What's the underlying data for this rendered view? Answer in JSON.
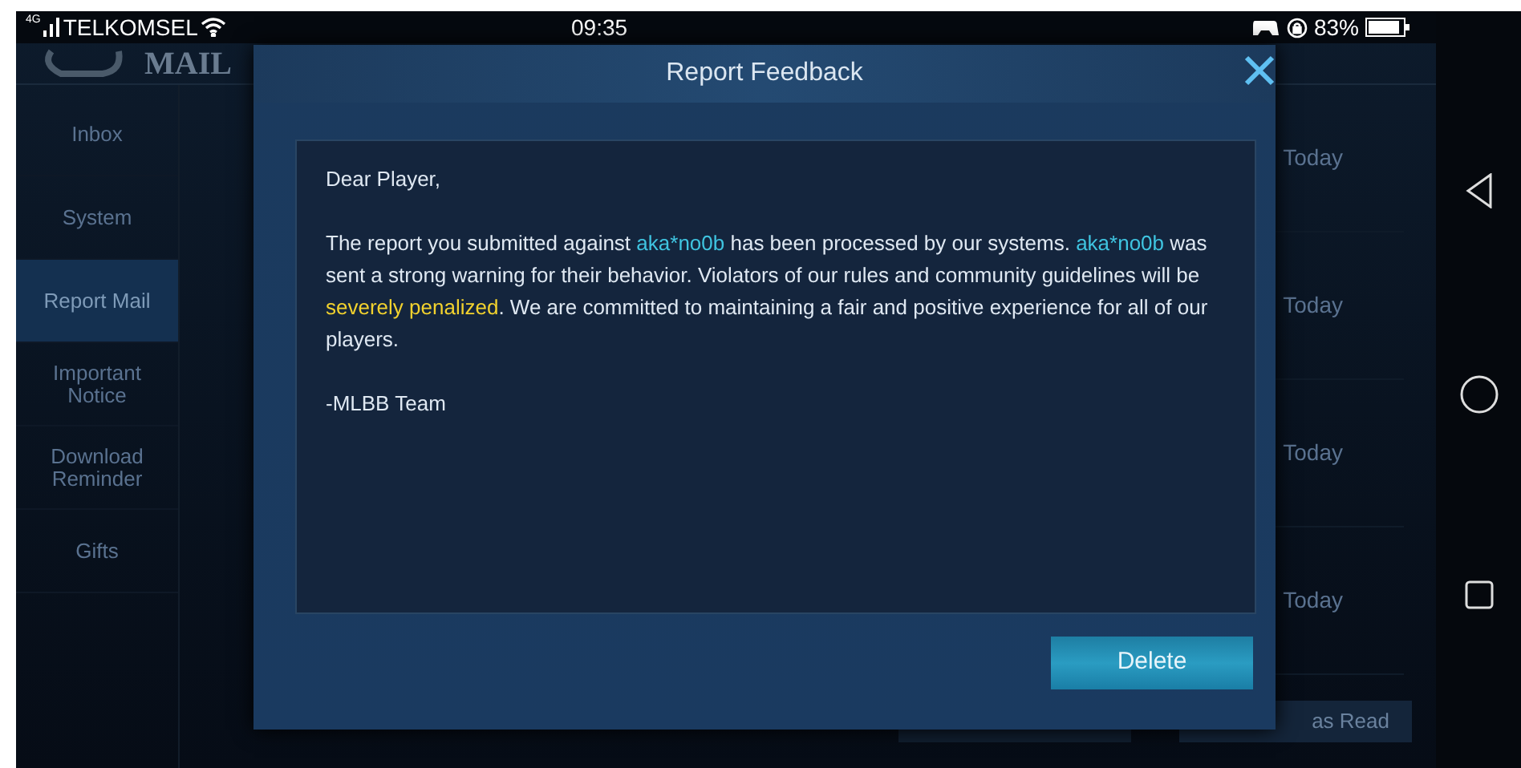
{
  "status_bar": {
    "network": "4G",
    "carrier": "TELKOMSEL",
    "time": "09:35",
    "battery": "83%"
  },
  "header": {
    "title": "MAIL"
  },
  "sidebar": {
    "items": [
      {
        "label": "Inbox",
        "selected": false
      },
      {
        "label": "System",
        "selected": false
      },
      {
        "label": "Report Mail",
        "selected": true
      },
      {
        "label": "Important Notice",
        "selected": false
      },
      {
        "label": "Download Reminder",
        "selected": false
      },
      {
        "label": "Gifts",
        "selected": false
      }
    ]
  },
  "mail_list": {
    "rows": [
      {
        "date": "Today"
      },
      {
        "date": "Today"
      },
      {
        "date": "Today"
      },
      {
        "date": "Today"
      }
    ]
  },
  "bottom_buttons": [
    {
      "label": "as Read"
    }
  ],
  "dialog": {
    "title": "Report Feedback",
    "greeting": "Dear Player,",
    "body": [
      {
        "kind": "plain",
        "text": "The report you submitted against "
      },
      {
        "kind": "name",
        "text": "aka*no0b"
      },
      {
        "kind": "plain",
        "text": " has been processed by our systems. "
      },
      {
        "kind": "name",
        "text": "aka*no0b"
      },
      {
        "kind": "plain",
        "text": " was sent a strong warning for their behavior. Violators of our rules and community guidelines will be "
      },
      {
        "kind": "warning",
        "text": "severely penalized"
      },
      {
        "kind": "plain",
        "text": ". We are committed to maintaining a fair and positive experience for all of our players."
      }
    ],
    "signature": "-MLBB Team",
    "button": "Delete"
  }
}
